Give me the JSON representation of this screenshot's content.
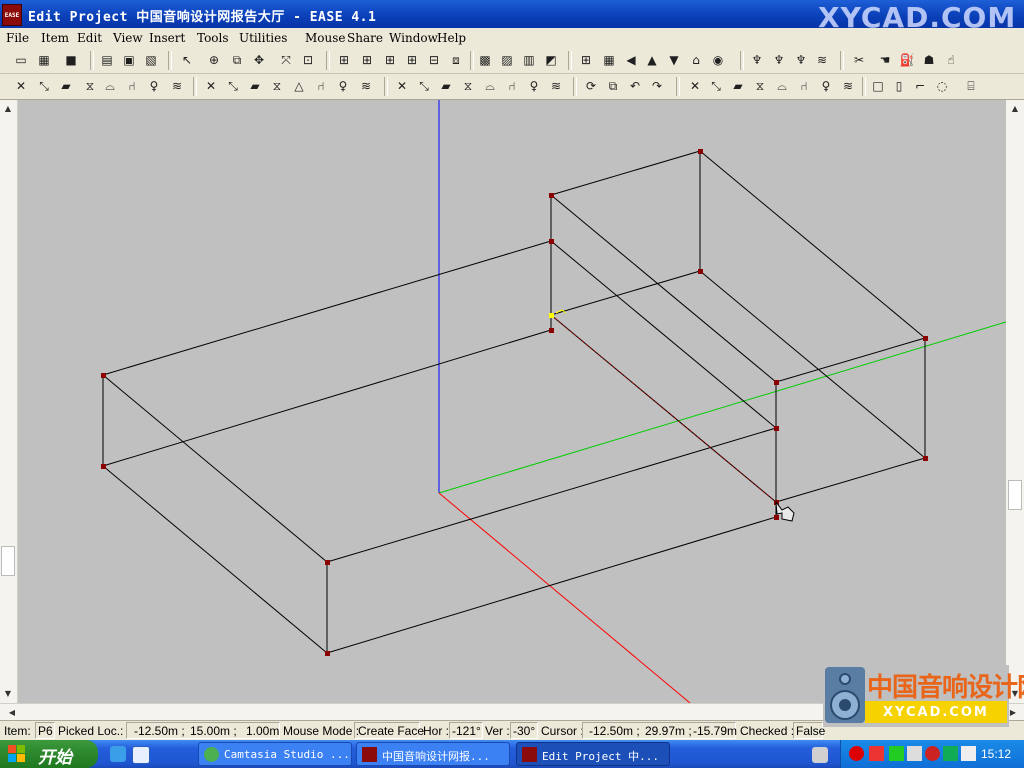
{
  "window": {
    "title": "Edit Project 中国音响设计网报告大厅 - EASE 4.1",
    "app_icon_text": "EASE",
    "watermark": "XYCAD.COM"
  },
  "menu": [
    "File",
    "Item",
    "Edit",
    "View",
    "Insert",
    "Tools",
    "Utilities",
    "Mouse",
    "Share",
    "Window",
    "Help"
  ],
  "status": {
    "item_label": "Item:",
    "item_value": "P6",
    "picked_label": "Picked Loc.:",
    "picked_x": "-12.50m ;",
    "picked_y": "15.00m ;",
    "picked_z": "1.00m",
    "mode_label": "Mouse Mode :",
    "mode_value": "Create Face",
    "hor_label": "Hor :",
    "hor_value": "-121°",
    "ver_label": "Ver :",
    "ver_value": "-30°",
    "cursor_label": "Cursor :",
    "cursor_x": "-12.50m ;",
    "cursor_y": "29.97m ;",
    "cursor_z": "-15.79m",
    "checked_label": "Checked :",
    "checked_value": "False"
  },
  "logo": {
    "title": "中国音响设计网",
    "subtitle": "XYCAD.COM"
  },
  "taskbar": {
    "start_label": "开始",
    "tasks": [
      "Camtasia Studio ...",
      "中国音响设计网报...",
      "Edit Project 中..."
    ],
    "clock": "15:12"
  },
  "colors": {
    "axis_x": "#ff0000",
    "axis_y": "#00cc00",
    "axis_z": "#0000ff",
    "vertex": "#8b0000",
    "selected": "#ffff00",
    "canvas": "#c0c0c0"
  },
  "toolbar_icons_row1": [
    "new-icon",
    "open-icon",
    "save-icon",
    "print-icon",
    "preview-icon",
    "export-icon",
    "pointer-icon",
    "target-icon",
    "copy-icon",
    "move-icon",
    "fit-icon",
    "zoom-icon",
    "view-top-icon",
    "view-front-icon",
    "view-side-icon",
    "view-iso-icon",
    "view-3d-icon",
    "render-icon",
    "color-icon",
    "map-icon",
    "grid-icon",
    "table-icon",
    "arrow-left-icon",
    "arrow-up-icon",
    "arrow-down-icon",
    "home-icon",
    "speaker-icon",
    "speaker-tree-icon",
    "speaker-array-icon",
    "light-icon",
    "wave-icon",
    "scissors-icon",
    "hand-icon",
    "paint-icon",
    "group-icon",
    "hand-point-icon"
  ],
  "toolbar_icons_row2": [
    "delete-icon",
    "add-vertex-icon",
    "face-icon",
    "mirror-icon",
    "arc-icon",
    "chair-icon",
    "bulb-icon",
    "wave-icon",
    "vertex-text-icon",
    "edge-icon",
    "face-edit-icon",
    "connect-icon",
    "triangle-icon",
    "split-icon",
    "probe-icon",
    "sound-icon",
    "delete2-icon",
    "cut-icon",
    "area-icon",
    "mirror2-icon",
    "flat-icon",
    "chair2-icon",
    "bulb2-icon",
    "wave2-icon",
    "rotate-icon",
    "copy-face-icon",
    "undo-icon",
    "redo-icon",
    "delete3-icon",
    "join-icon",
    "face2-icon",
    "mirror3-icon",
    "arc2-icon",
    "chair3-icon",
    "bulb3-icon",
    "wave3-icon",
    "box-icon",
    "box-door-icon",
    "box-step-icon",
    "box-round-icon",
    "cylinder-icon"
  ]
}
